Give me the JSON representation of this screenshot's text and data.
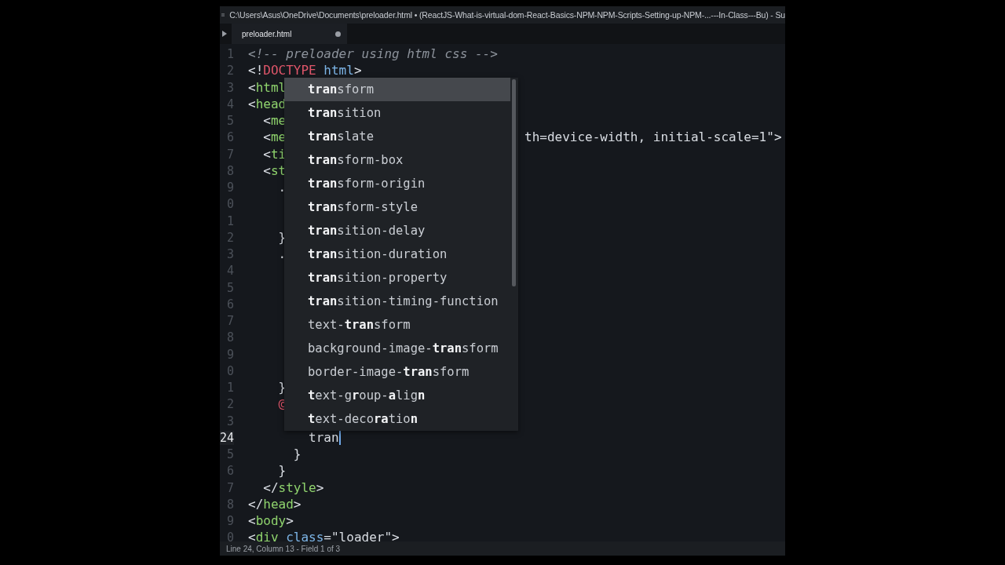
{
  "window": {
    "title": "C:\\Users\\Asus\\OneDrive\\Documents\\preloader.html • (ReactJS-What-is-virtual-dom-React-Basics-NPM-NPM-Scripts-Setting-up-NPM-...---In-Class---Bu) - Su"
  },
  "tabs": [
    {
      "label": "preloader.html",
      "selected": true,
      "modified": true
    }
  ],
  "editor": {
    "lines": [
      {
        "number": "1",
        "current": false,
        "segments": [
          {
            "text": "<!-- preloader using html css -->",
            "kind": "comment"
          }
        ]
      },
      {
        "number": "2",
        "current": false,
        "segments": [
          {
            "text": "<!",
            "kind": "punct"
          },
          {
            "text": "DOCTYPE",
            "kind": "keyword"
          },
          {
            "text": " html",
            "kind": "attr"
          },
          {
            "text": ">",
            "kind": "punct"
          }
        ]
      },
      {
        "number": "3",
        "current": false,
        "segments": [
          {
            "text": "<",
            "kind": "punct"
          },
          {
            "text": "html",
            "kind": "tag"
          }
        ]
      },
      {
        "number": "4",
        "current": false,
        "segments": [
          {
            "text": "<",
            "kind": "punct"
          },
          {
            "text": "head",
            "kind": "tag"
          }
        ]
      },
      {
        "number": "5",
        "current": false,
        "segments": [
          {
            "text": "  <",
            "kind": "punct"
          },
          {
            "text": "me",
            "kind": "tag"
          }
        ]
      },
      {
        "number": "6",
        "current": false,
        "segments": [
          {
            "text": "  <",
            "kind": "punct"
          },
          {
            "text": "me",
            "kind": "tag"
          }
        ],
        "tail": "th=device-width, initial-scale=1\">"
      },
      {
        "number": "7",
        "current": false,
        "segments": [
          {
            "text": "  <",
            "kind": "punct"
          },
          {
            "text": "ti",
            "kind": "tag"
          }
        ]
      },
      {
        "number": "8",
        "current": false,
        "segments": [
          {
            "text": "  <",
            "kind": "punct"
          },
          {
            "text": "st",
            "kind": "tag"
          }
        ]
      },
      {
        "number": "9",
        "current": false,
        "segments": [
          {
            "text": "    .",
            "kind": "punct"
          }
        ]
      },
      {
        "number": "0",
        "current": false
      },
      {
        "number": "1",
        "current": false
      },
      {
        "number": "2",
        "current": false,
        "segments": [
          {
            "text": "    }",
            "kind": "punct"
          }
        ]
      },
      {
        "number": "3",
        "current": false,
        "segments": [
          {
            "text": "    .",
            "kind": "punct"
          }
        ]
      },
      {
        "number": "4",
        "current": false
      },
      {
        "number": "5",
        "current": false
      },
      {
        "number": "6",
        "current": false
      },
      {
        "number": "7",
        "current": false
      },
      {
        "number": "8",
        "current": false
      },
      {
        "number": "9",
        "current": false
      },
      {
        "number": "0",
        "current": false
      },
      {
        "number": "1",
        "current": false,
        "segments": [
          {
            "text": "    }",
            "kind": "punct"
          }
        ]
      },
      {
        "number": "2",
        "current": false,
        "segments": [
          {
            "text": "    @",
            "kind": "keyword"
          }
        ]
      },
      {
        "number": "3",
        "current": false
      },
      {
        "number": "24",
        "current": true,
        "segments": [
          {
            "text": "        tran",
            "kind": "punct"
          }
        ]
      },
      {
        "number": "5",
        "current": false,
        "segments": [
          {
            "text": "      }",
            "kind": "punct"
          }
        ]
      },
      {
        "number": "6",
        "current": false,
        "segments": [
          {
            "text": "    }",
            "kind": "punct"
          }
        ]
      },
      {
        "number": "7",
        "current": false,
        "segments": [
          {
            "text": "  </",
            "kind": "punct"
          },
          {
            "text": "style",
            "kind": "tag"
          },
          {
            "text": ">",
            "kind": "punct"
          }
        ]
      },
      {
        "number": "8",
        "current": false,
        "segments": [
          {
            "text": "</",
            "kind": "punct"
          },
          {
            "text": "head",
            "kind": "tag"
          },
          {
            "text": ">",
            "kind": "punct"
          }
        ]
      },
      {
        "number": "9",
        "current": false,
        "segments": [
          {
            "text": "<",
            "kind": "punct"
          },
          {
            "text": "body",
            "kind": "tag"
          },
          {
            "text": ">",
            "kind": "punct"
          }
        ]
      },
      {
        "number": "0",
        "current": false,
        "segments": [
          {
            "text": "<",
            "kind": "punct"
          },
          {
            "text": "div",
            "kind": "tag"
          },
          {
            "text": " class",
            "kind": "attr"
          },
          {
            "text": "=\"loader\">",
            "kind": "punct"
          }
        ]
      }
    ]
  },
  "autocomplete": {
    "items": [
      {
        "label": "**tran**sform",
        "selected": true
      },
      {
        "label": "**tran**sition",
        "selected": false
      },
      {
        "label": "**tran**slate",
        "selected": false
      },
      {
        "label": "**tran**sform-box",
        "selected": false
      },
      {
        "label": "**tran**sform-origin",
        "selected": false
      },
      {
        "label": "**tran**sform-style",
        "selected": false
      },
      {
        "label": "**tran**sition-delay",
        "selected": false
      },
      {
        "label": "**tran**sition-duration",
        "selected": false
      },
      {
        "label": "**tran**sition-property",
        "selected": false
      },
      {
        "label": "**tran**sition-timing-function",
        "selected": false
      },
      {
        "label": "text-**tran**sform",
        "selected": false
      },
      {
        "label": "background-image-**tran**sform",
        "selected": false
      },
      {
        "label": "border-image-**tran**sform",
        "selected": false
      },
      {
        "label": "**t**ext-g**r**oup-**a**lig**n**",
        "selected": false
      },
      {
        "label": "**t**ext-deco**ra**tio**n**",
        "selected": false
      }
    ]
  },
  "status_bar": "Line 24, Column 13 - Field 1 of 3"
}
